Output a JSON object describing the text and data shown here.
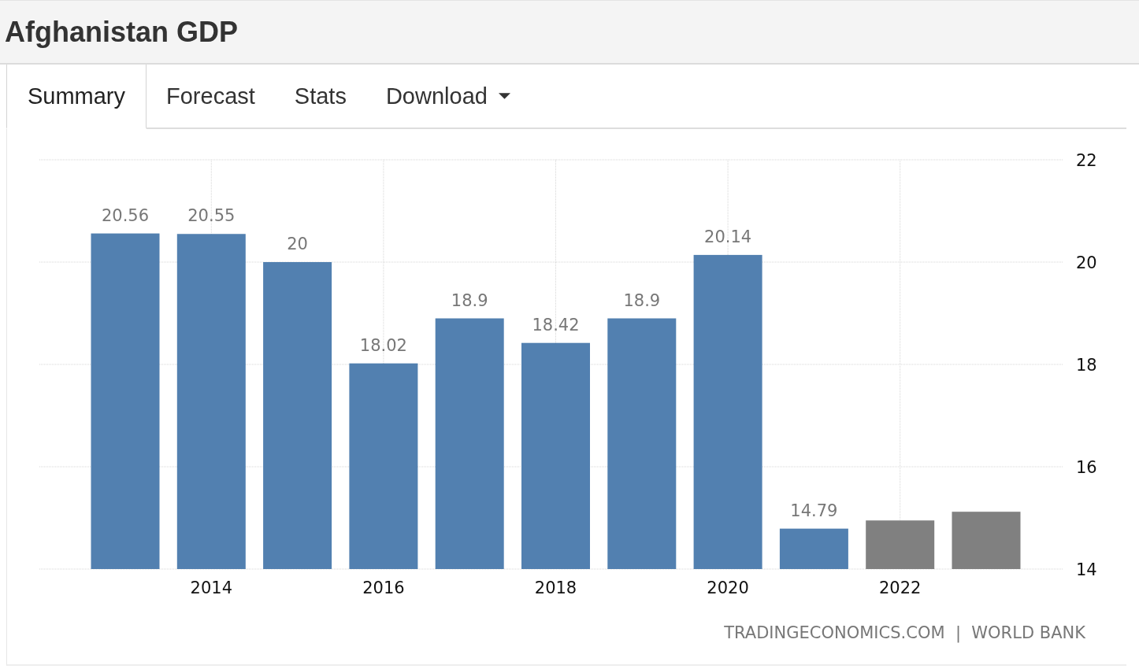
{
  "page": {
    "title": "Afghanistan GDP"
  },
  "tabs": [
    {
      "label": "Summary",
      "selected": true,
      "kind": "tab"
    },
    {
      "label": "Forecast",
      "selected": false,
      "kind": "tab"
    },
    {
      "label": "Stats",
      "selected": false,
      "kind": "tab"
    },
    {
      "label": "Download",
      "selected": false,
      "kind": "dropdown"
    }
  ],
  "chart": {
    "chart_data": {
      "type": "bar",
      "categories": [
        null,
        "2014",
        null,
        "2016",
        null,
        "2018",
        null,
        "2020",
        null,
        "2022",
        null
      ],
      "grid": true,
      "series": [
        {
          "color": "#5280b0",
          "values": [
            20.56,
            20.55,
            20,
            18.02,
            18.9,
            18.42,
            18.9,
            20.14,
            14.79,
            null,
            null
          ]
        },
        {
          "color": "#808080",
          "values": [
            null,
            null,
            null,
            null,
            null,
            null,
            null,
            null,
            null,
            14.95,
            15.12
          ]
        }
      ],
      "value_labels": [
        "20.56",
        "20.55",
        "20",
        "18.02",
        "18.9",
        "18.42",
        "18.9",
        "20.14",
        "14.79",
        null,
        null
      ],
      "ylim": [
        14,
        22
      ],
      "yticks": [
        14,
        16,
        18,
        20,
        22
      ]
    },
    "source": "TRADINGECONOMICS.COM  |  WORLD BANK"
  }
}
